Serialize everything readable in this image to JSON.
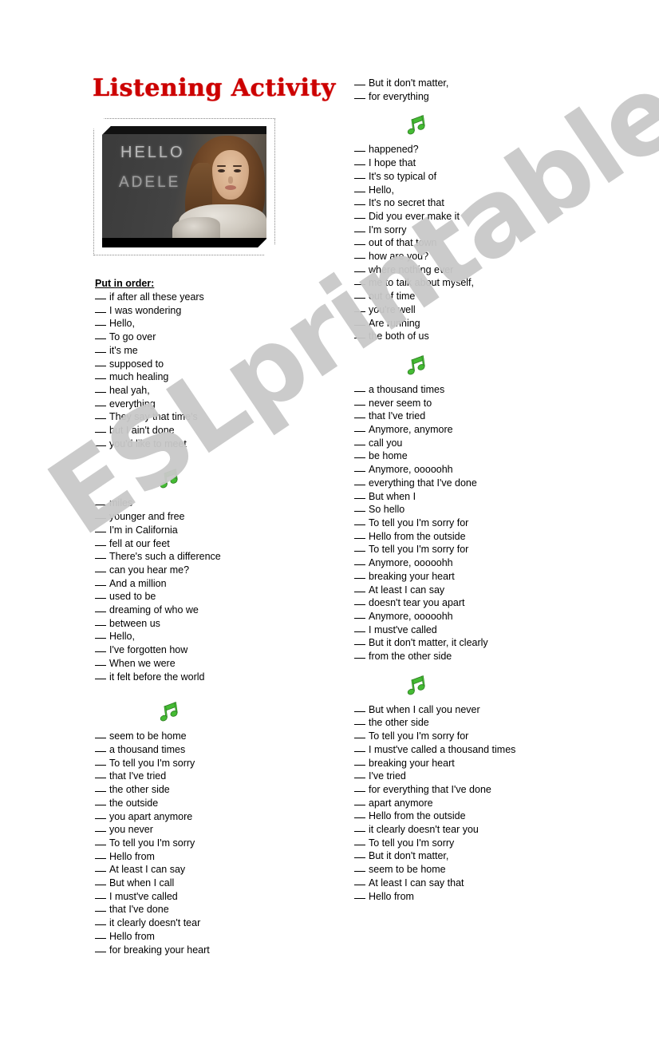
{
  "title": "Listening Activity",
  "watermark": "ESLprintables.com",
  "photo": {
    "word_top": "HELLO",
    "word_bottom": "ADELE",
    "alt": "Adele Hello album cover"
  },
  "colors": {
    "title": "#cc0000",
    "note": "#44bb33",
    "watermark": "#c9c9c9",
    "text": "#000000"
  },
  "icons": {
    "music_note": "music-note-icon"
  },
  "left_column": {
    "heading": "Put in order:",
    "blocks": [
      {
        "has_note": false,
        "items": [
          "if after all these years",
          "I was wondering",
          "Hello,",
          "To go over",
          "it's me",
          "supposed to",
          "much healing",
          "heal yah,",
          "everything",
          "They say that time's",
          "but I ain't done",
          "you'd like to meet"
        ]
      },
      {
        "has_note": true,
        "items": [
          "miles",
          "younger and free",
          "I'm in California",
          "fell at our feet",
          "There's such a difference",
          "can you hear me?",
          "And a million",
          "used to be",
          "dreaming of who we",
          "between us",
          "Hello,",
          "I've forgotten how",
          "When we were",
          "it felt before the world"
        ]
      },
      {
        "has_note": true,
        "items": [
          "seem to be home",
          "a thousand times",
          "To tell you I'm sorry",
          "that I've tried",
          "the other side",
          "the outside",
          "you apart anymore",
          "you never",
          "To tell you I'm sorry",
          "Hello from",
          "At least I can say",
          "But when I call",
          "I must've called",
          "that I've done",
          "it clearly doesn't tear",
          "Hello from",
          "for breaking your heart"
        ]
      }
    ]
  },
  "right_column": {
    "blocks": [
      {
        "has_note": false,
        "items": [
          "But it don't matter,",
          "for everything"
        ]
      },
      {
        "has_note": true,
        "items": [
          "happened?",
          "I hope that",
          "It's so typical of",
          "Hello,",
          "It's no secret that",
          "Did you ever make it",
          "I'm sorry",
          "out of that town",
          "how are you?",
          "where nothing ever",
          "me to talk about myself,",
          "out of time",
          "you're well",
          "Are running",
          "the both of us"
        ]
      },
      {
        "has_note": true,
        "items": [
          "a thousand times",
          "never seem to",
          "that I've tried",
          "Anymore, anymore",
          "call you",
          "be home",
          "Anymore, ooooohh",
          "everything that I've done",
          "But when I",
          "So hello",
          "To tell you I'm sorry for",
          "Hello from the outside",
          "To tell you I'm sorry for",
          "Anymore, ooooohh",
          "breaking your heart",
          "At least I can say",
          "doesn't tear you apart",
          "Anymore, ooooohh",
          "I must've called",
          "But it don't matter, it clearly",
          "from the other side"
        ]
      },
      {
        "has_note": true,
        "items": [
          "But when I call you never",
          "the other side",
          "To tell you I'm sorry for",
          "I must've called a thousand times",
          "breaking your heart",
          "I've tried",
          "for everything that I've done",
          "apart anymore",
          "Hello from the outside",
          "it clearly doesn't tear you",
          "To tell you I'm sorry",
          "But it don't matter,",
          "seem to be home",
          "At least I can say that",
          "Hello from"
        ]
      }
    ]
  }
}
